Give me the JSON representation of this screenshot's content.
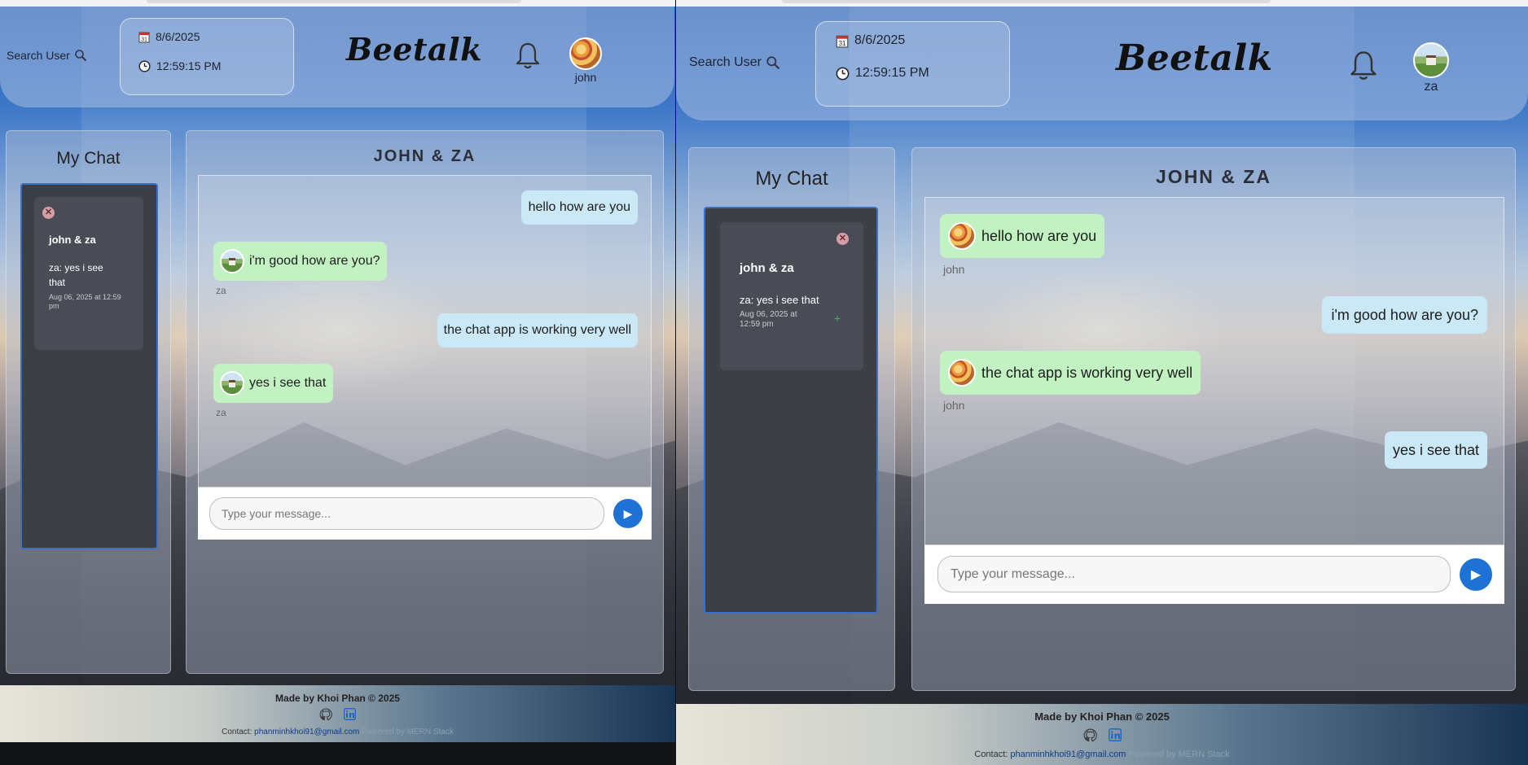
{
  "colors": {
    "accent": "#1e72d6",
    "my_bubble": "#cbe8f7",
    "their_bubble": "#c2f2c2",
    "chat_list_bg": "#3d3f47"
  },
  "left": {
    "header": {
      "search_label": "Search User",
      "date": "8/6/2025",
      "time": "12:59:15 PM",
      "logo": "Beetalk",
      "username": "john",
      "avatar": "pizza"
    },
    "sidebar": {
      "title": "My Chat",
      "chats": [
        {
          "name": "john & za",
          "last_message": "za: yes i see that",
          "time": "Aug 06, 2025 at 12:59 pm"
        }
      ]
    },
    "conversation": {
      "title": "JOHN & ZA",
      "messages": [
        {
          "text": "hello how are you",
          "from": "me"
        },
        {
          "text": "i'm good how are you?",
          "from": "them",
          "sender": "za"
        },
        {
          "text": "the chat app is working very well",
          "from": "me"
        },
        {
          "text": "yes i see that",
          "from": "them",
          "sender": "za"
        }
      ],
      "input_placeholder": "Type your message..."
    }
  },
  "right": {
    "header": {
      "search_label": "Search User",
      "date": "8/6/2025",
      "time": "12:59:15 PM",
      "logo": "Beetalk",
      "username": "za",
      "avatar": "field"
    },
    "sidebar": {
      "title": "My Chat",
      "chats": [
        {
          "name": "john & za",
          "last_message": "za: yes i see that",
          "time": "Aug 06, 2025 at 12:59 pm"
        }
      ]
    },
    "conversation": {
      "title": "JOHN & ZA",
      "messages": [
        {
          "text": "hello how are you",
          "from": "them",
          "sender": "john"
        },
        {
          "text": "i'm good how are you?",
          "from": "me"
        },
        {
          "text": "the chat app is working very well",
          "from": "them",
          "sender": "john"
        },
        {
          "text": "yes i see that",
          "from": "me"
        }
      ],
      "input_placeholder": "Type your message..."
    }
  },
  "footer": {
    "made_by": "Made by Khoi Phan © 2025",
    "contact_label": "Contact:",
    "email": "phanminhkhoi91@gmail.com",
    "powered_by": "Powered by MERN Stack",
    "icons": [
      "github-icon",
      "linkedin-icon"
    ]
  }
}
